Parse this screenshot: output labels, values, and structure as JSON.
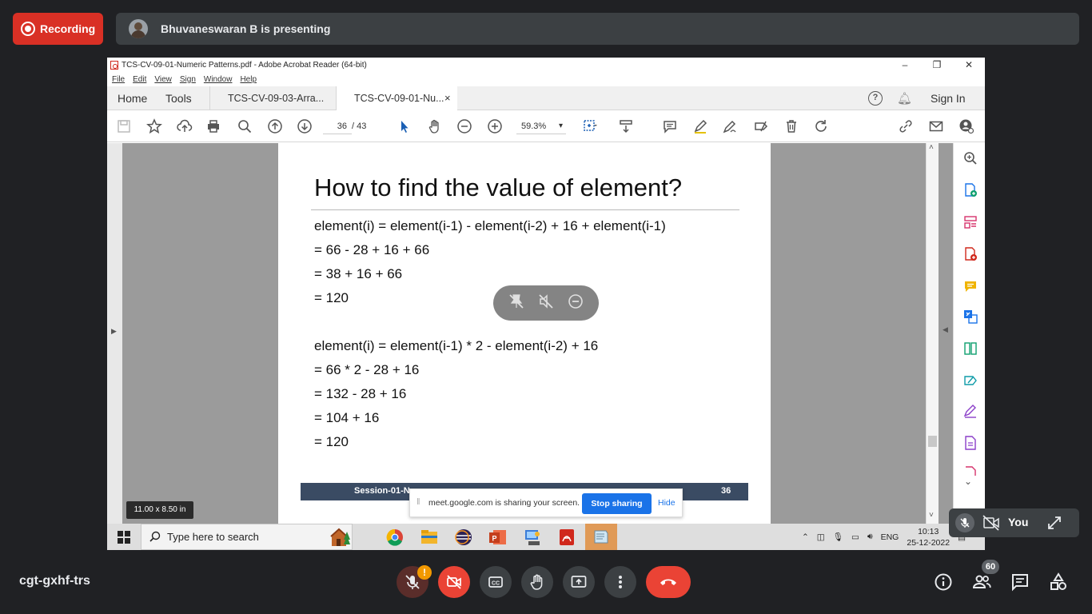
{
  "meet": {
    "recording_label": "Recording",
    "presenting_text": "Bhuvaneswaran B is presenting",
    "meeting_code": "cgt-gxhf-trs",
    "self_label": "You",
    "participant_count": "60"
  },
  "acrobat": {
    "window_title": "TCS-CV-09-01-Numeric Patterns.pdf - Adobe Acrobat Reader (64-bit)",
    "menu": [
      "File",
      "Edit",
      "View",
      "Sign",
      "Window",
      "Help"
    ],
    "nav_home": "Home",
    "nav_tools": "Tools",
    "tab1": "TCS-CV-09-03-Arra...",
    "tab2": "TCS-CV-09-01-Nu...",
    "tab_close": "×",
    "sign_in": "Sign In",
    "page_current": "36",
    "page_total": "/  43",
    "zoom": "59.3%",
    "page_size": "11.00 x 8.50 in"
  },
  "slide": {
    "title": "How to find the value of element?",
    "lines1": [
      "element(i) = element(i-1) - element(i-2) + 16 + element(i-1)",
      "= 66 - 28 + 16 + 66",
      "= 38 + 16 + 66",
      "= 120"
    ],
    "lines2": [
      "element(i) = element(i-1) * 2 - element(i-2) + 16",
      "= 66 * 2 - 28 + 16",
      "= 132 - 28 + 16",
      "= 104 + 16",
      "= 120"
    ],
    "footer_left": "Session-01-Nu",
    "footer_right": "36"
  },
  "share_bar": {
    "message": "meet.google.com is sharing your screen.",
    "stop_label": "Stop sharing",
    "hide_label": "Hide"
  },
  "taskbar": {
    "search_placeholder": "Type here to search",
    "lang": "ENG",
    "time": "10:13",
    "date": "25-12-2022"
  },
  "colors": {
    "recording_red": "#d93025",
    "meet_dark": "#202124",
    "meet_chip": "#3c4043",
    "stop_blue": "#1a73e8",
    "slide_footer": "#3a4b63"
  }
}
